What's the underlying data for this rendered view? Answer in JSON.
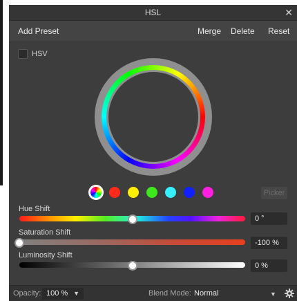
{
  "window": {
    "title": "HSL",
    "close_glyph": "✕"
  },
  "toolbar": {
    "add_preset": "Add Preset",
    "merge": "Merge",
    "delete": "Delete",
    "reset": "Reset"
  },
  "hsv_checkbox": {
    "label": "HSV",
    "checked": false
  },
  "swatches": [
    "master",
    "#ff2a1a",
    "#ffee00",
    "#3ee81c",
    "#37f0ff",
    "#1020ff",
    "#ff20e0"
  ],
  "picker_label": "Picker",
  "sliders": {
    "hue": {
      "label": "Hue Shift",
      "value": "0 °",
      "position": 0.5
    },
    "saturation": {
      "label": "Saturation Shift",
      "value": "-100 %",
      "position": 0.0
    },
    "luminosity": {
      "label": "Luminosity Shift",
      "value": "0 %",
      "position": 0.5
    }
  },
  "bottom": {
    "opacity_label": "Opacity:",
    "opacity_value": "100 %",
    "blend_label": "Blend Mode:",
    "blend_value": "Normal"
  },
  "icons": [
    "close-icon",
    "color-wheel-icon",
    "chevron-down-icon",
    "gear-icon"
  ]
}
